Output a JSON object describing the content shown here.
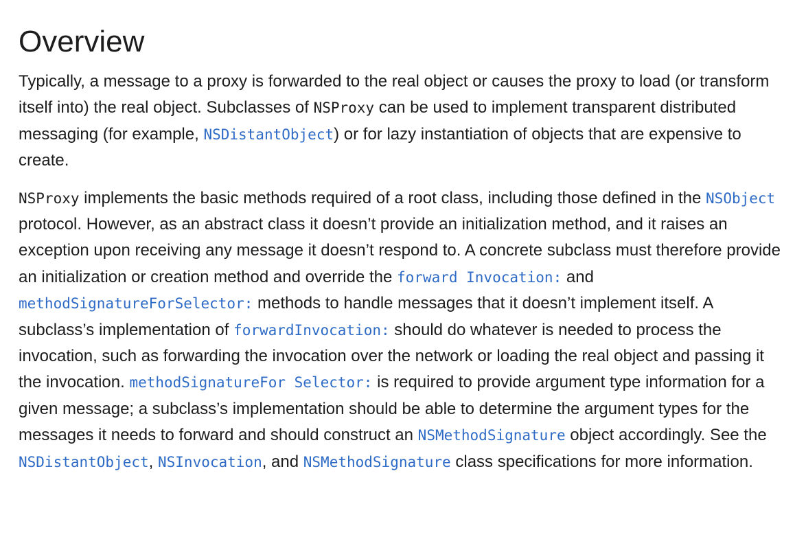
{
  "heading": "Overview",
  "colors": {
    "text": "#1d1d1f",
    "link": "#2e6bc6",
    "background": "#ffffff"
  },
  "paragraph1": {
    "t1": "Typically, a message to a proxy is forwarded to the real object or causes the proxy to load (or transform itself into) the real object. Subclasses of ",
    "code1": "NSProxy",
    "t2": " can be used to implement transparent distributed messaging (for example, ",
    "link1": "NSDistantObject",
    "t3": ") or for lazy instantiation of objects that are expensive to create."
  },
  "paragraph2": {
    "code1": "NSProxy",
    "t1": " implements the basic methods required of a root class, including those defined in the ",
    "link1": "NSObject",
    "t2": " protocol. However, as an abstract class it doesn’t provide an initialization method, and it raises an exception upon receiving any message it doesn’t respond to. A concrete subclass must therefore provide an initialization or creation method and override the ",
    "link2": "forward Invocation:",
    "t3": " and ",
    "link3": "methodSignatureForSelector:",
    "t4": " methods to handle messages that it doesn’t implement itself. A subclass’s implementation of ",
    "link4": "forwardInvocation:",
    "t5": " should do whatever is needed to process the invocation, such as forwarding the invocation over the network or loading the real object and passing it the invocation. ",
    "link5": "methodSignatureFor Selector:",
    "t6": " is required to provide argument type information for a given message; a subclass’s implementation should be able to determine the argument types for the messages it needs to forward and should construct an ",
    "link6": "NSMethodSignature",
    "t7": " object accordingly. See the ",
    "link7": "NSDistantObject",
    "t8": ", ",
    "link8": "NSInvocation",
    "t9": ", and ",
    "link9": "NSMethodSignature",
    "t10": " class specifications for more information."
  }
}
